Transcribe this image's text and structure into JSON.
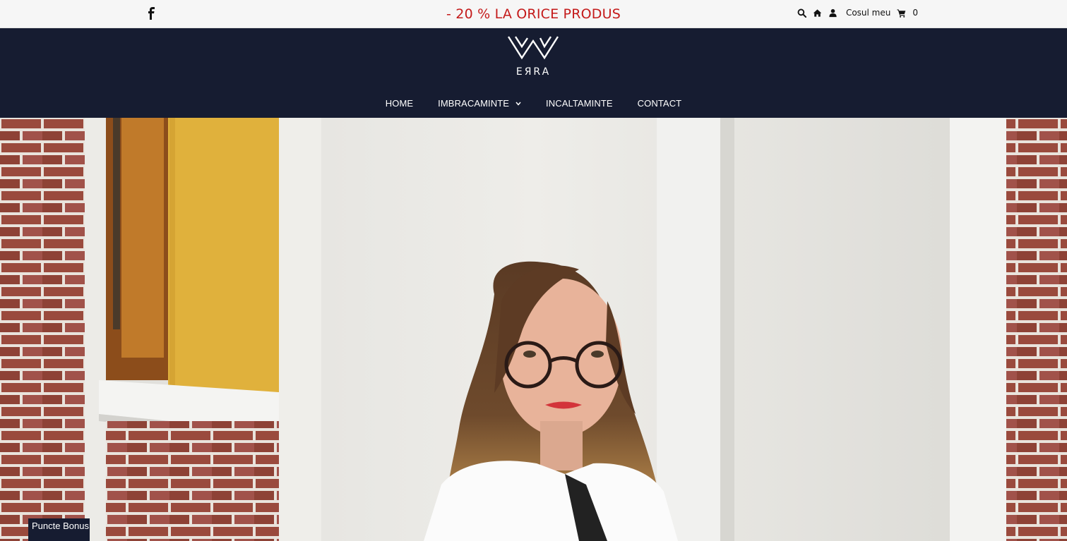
{
  "topbar": {
    "promo_text": "- 20 % LA ORICE PRODUS",
    "cart_label": "Cosul meu",
    "cart_count": "0",
    "promo_color": "#c41a1a",
    "icons": [
      "facebook-icon",
      "search-icon",
      "home-icon",
      "user-icon",
      "cart-icon"
    ]
  },
  "header": {
    "logo_text": "EЯRA",
    "background": "#161c31"
  },
  "nav": {
    "items": [
      {
        "label": "HOME"
      },
      {
        "label": "IMBRACAMINTE",
        "has_dropdown": true
      },
      {
        "label": "INCALTAMINTE"
      },
      {
        "label": "CONTACT"
      }
    ]
  },
  "hero": {
    "image": "woman-with-glasses-photo"
  },
  "bonus": {
    "label": "Puncte Bonus"
  }
}
